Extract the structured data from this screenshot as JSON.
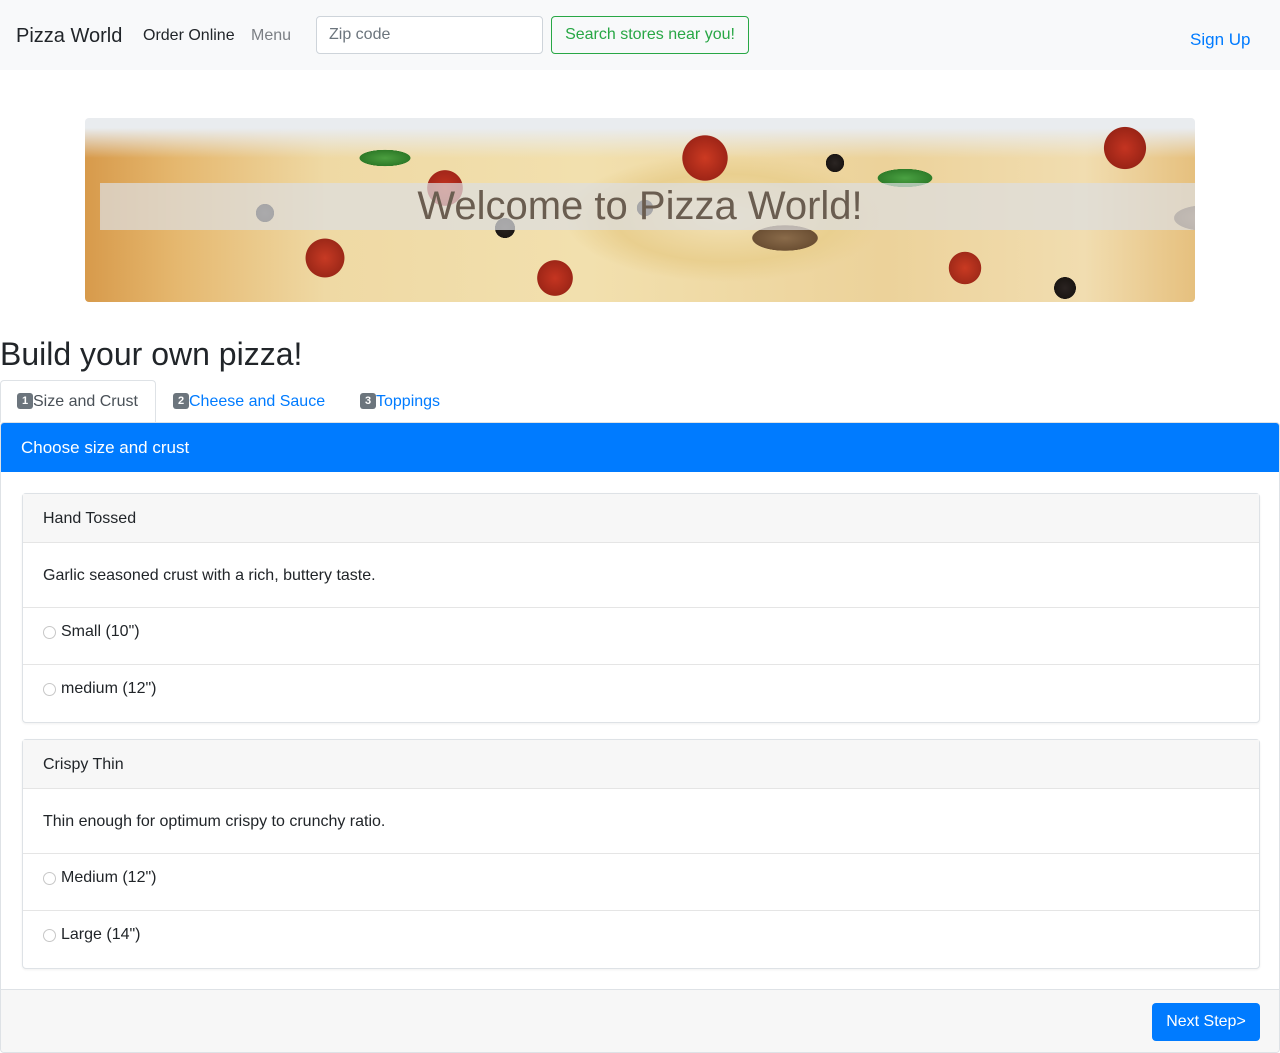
{
  "navbar": {
    "brand": "Pizza World",
    "links": [
      {
        "label": "Order Online"
      },
      {
        "label": "Menu"
      }
    ],
    "search": {
      "placeholder": "Zip code",
      "value": ""
    },
    "search_button": "Search stores near you!",
    "signup": "Sign Up"
  },
  "hero": {
    "title": "Welcome to Pizza World!"
  },
  "builder": {
    "title": "Build your own pizza!",
    "tabs": [
      {
        "number": "1",
        "label": "Size and Crust"
      },
      {
        "number": "2",
        "label": "Cheese and Sauce"
      },
      {
        "number": "3",
        "label": "Toppings"
      }
    ],
    "panel_title": "Choose size and crust",
    "crusts": [
      {
        "name": "Hand Tossed",
        "description": "Garlic seasoned crust with a rich, buttery taste.",
        "options": [
          "Small (10\")",
          "medium (12\")"
        ]
      },
      {
        "name": "Crispy Thin",
        "description": "Thin enough for optimum crispy to crunchy ratio.",
        "options": [
          "Medium (12\")",
          "Large (14\")"
        ]
      }
    ],
    "next_button": "Next Step>"
  }
}
